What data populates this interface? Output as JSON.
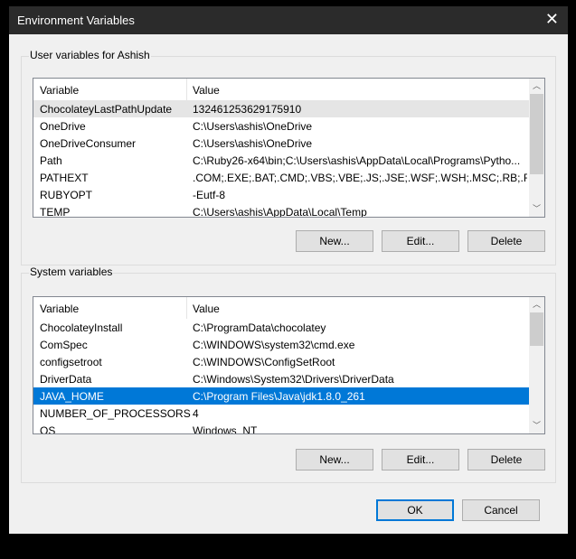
{
  "window": {
    "title": "Environment Variables",
    "close_icon": "close-icon"
  },
  "user": {
    "label": "User variables for Ashish",
    "columns": [
      "Variable",
      "Value"
    ],
    "rows": [
      {
        "name": "ChocolateyLastPathUpdate",
        "value": "132461253629175910"
      },
      {
        "name": "OneDrive",
        "value": "C:\\Users\\ashis\\OneDrive"
      },
      {
        "name": "OneDriveConsumer",
        "value": "C:\\Users\\ashis\\OneDrive"
      },
      {
        "name": "Path",
        "value": "C:\\Ruby26-x64\\bin;C:\\Users\\ashis\\AppData\\Local\\Programs\\Pytho..."
      },
      {
        "name": "PATHEXT",
        "value": ".COM;.EXE;.BAT;.CMD;.VBS;.VBE;.JS;.JSE;.WSF;.WSH;.MSC;.RB;.RBW;...."
      },
      {
        "name": "RUBYOPT",
        "value": "-Eutf-8"
      },
      {
        "name": "TEMP",
        "value": "C:\\Users\\ashis\\AppData\\Local\\Temp"
      }
    ],
    "buttons": {
      "new": "New...",
      "edit": "Edit...",
      "delete": "Delete"
    }
  },
  "system": {
    "label": "System variables",
    "columns": [
      "Variable",
      "Value"
    ],
    "rows": [
      {
        "name": "ChocolateyInstall",
        "value": "C:\\ProgramData\\chocolatey"
      },
      {
        "name": "ComSpec",
        "value": "C:\\WINDOWS\\system32\\cmd.exe"
      },
      {
        "name": "configsetroot",
        "value": "C:\\WINDOWS\\ConfigSetRoot"
      },
      {
        "name": "DriverData",
        "value": "C:\\Windows\\System32\\Drivers\\DriverData"
      },
      {
        "name": "JAVA_HOME",
        "value": "C:\\Program Files\\Java\\jdk1.8.0_261",
        "selected": true
      },
      {
        "name": "NUMBER_OF_PROCESSORS",
        "value": "4"
      },
      {
        "name": "OS",
        "value": "Windows_NT"
      }
    ],
    "buttons": {
      "new": "New...",
      "edit": "Edit...",
      "delete": "Delete"
    }
  },
  "footer": {
    "ok": "OK",
    "cancel": "Cancel"
  },
  "colors": {
    "selection": "#0078d7",
    "titlebar": "#2b2b2b"
  }
}
